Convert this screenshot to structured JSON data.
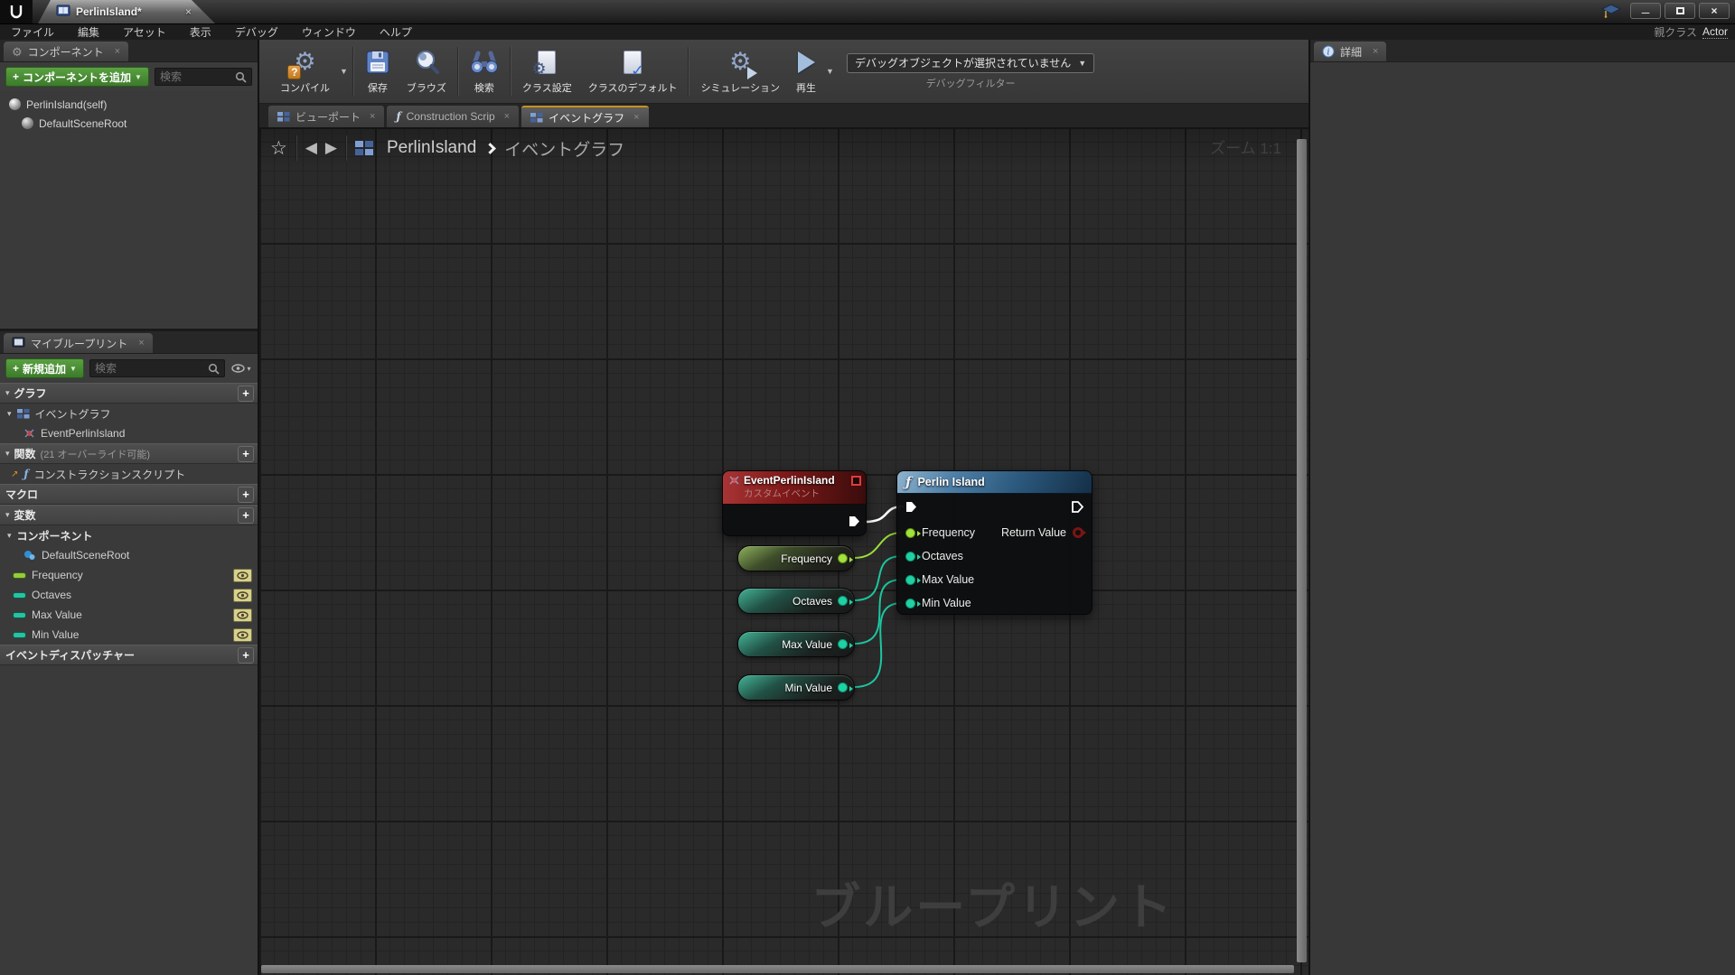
{
  "window": {
    "asset_tab_title": "PerlinIsland*",
    "parent_class_label": "親クラス",
    "parent_class_value": "Actor"
  },
  "glyphs": {
    "close": "×",
    "caret": "▼",
    "caret_small": "▾",
    "plus": "+",
    "star": "☆",
    "back": "◀",
    "forward": "▶",
    "gear": "⚙",
    "fn": "ƒ",
    "check": "✓",
    "question": "?",
    "minimize": "─",
    "construction_arrow": "↗",
    "logo": "U"
  },
  "menubar": {
    "items": [
      "ファイル",
      "編集",
      "アセット",
      "表示",
      "デバッグ",
      "ウィンドウ",
      "ヘルプ"
    ]
  },
  "toolbar": {
    "buttons": [
      {
        "label": "コンパイル"
      },
      {
        "label": "保存"
      },
      {
        "label": "ブラウズ"
      },
      {
        "label": "検索"
      },
      {
        "label": "クラス設定"
      },
      {
        "label": "クラスのデフォルト"
      },
      {
        "label": "シミュレーション"
      },
      {
        "label": "再生"
      }
    ],
    "debug_dropdown_value": "デバッグオブジェクトが選択されていません",
    "debug_filter_label": "デバッグフィルター"
  },
  "components_panel": {
    "tab_label": "コンポーネント",
    "add_button_label": "コンポーネントを追加",
    "search_placeholder": "検索",
    "items": [
      "PerlinIsland(self)",
      "DefaultSceneRoot"
    ]
  },
  "my_blueprint": {
    "tab_label": "マイブループリント",
    "add_button_label": "新規追加",
    "search_placeholder": "検索",
    "graph_section": "グラフ",
    "event_graph_item": "イベントグラフ",
    "event_item": "EventPerlinIsland",
    "functions_section": "関数",
    "functions_note": "(21 オーバーライド可能)",
    "construction_script_item": "コンストラクションスクリプト",
    "macro_section": "マクロ",
    "variables_section": "変数",
    "components_group": "コンポーネント",
    "scene_root_item": "DefaultSceneRoot",
    "variables": [
      "Frequency",
      "Octaves",
      "Max Value",
      "Min Value"
    ],
    "dispatcher_section": "イベントディスパッチャー"
  },
  "doc_tabs": {
    "viewport": "ビューポート",
    "construction": "Construction Scrip",
    "event_graph": "イベントグラフ"
  },
  "breadcrumb": {
    "asset": "PerlinIsland",
    "graph": "イベントグラフ"
  },
  "graph": {
    "zoom_label": "ズーム 1:1",
    "watermark": "ブループリント",
    "event_node": {
      "title": "EventPerlinIsland",
      "subtitle": "カスタムイベント"
    },
    "function_node": {
      "title": "Perlin Island",
      "inputs": [
        "Frequency",
        "Octaves",
        "Max Value",
        "Min Value"
      ],
      "output": "Return Value"
    },
    "variable_nodes": [
      "Frequency",
      "Octaves",
      "Max Value",
      "Min Value"
    ]
  },
  "details_panel": {
    "tab_label": "詳細"
  },
  "colors": {
    "active_tab_accent": "#c8921e",
    "add_button_green": "#4a8f3c",
    "exec_wire": "#ffffff",
    "float_pin_lime": "#a2e23c",
    "int_pin_teal": "#1fd2a5",
    "return_pin_red": "#7c1414",
    "event_node_header": "#8a1c1c",
    "function_node_header": "#3a6f9c",
    "graph_background": "#2a2a2a"
  }
}
